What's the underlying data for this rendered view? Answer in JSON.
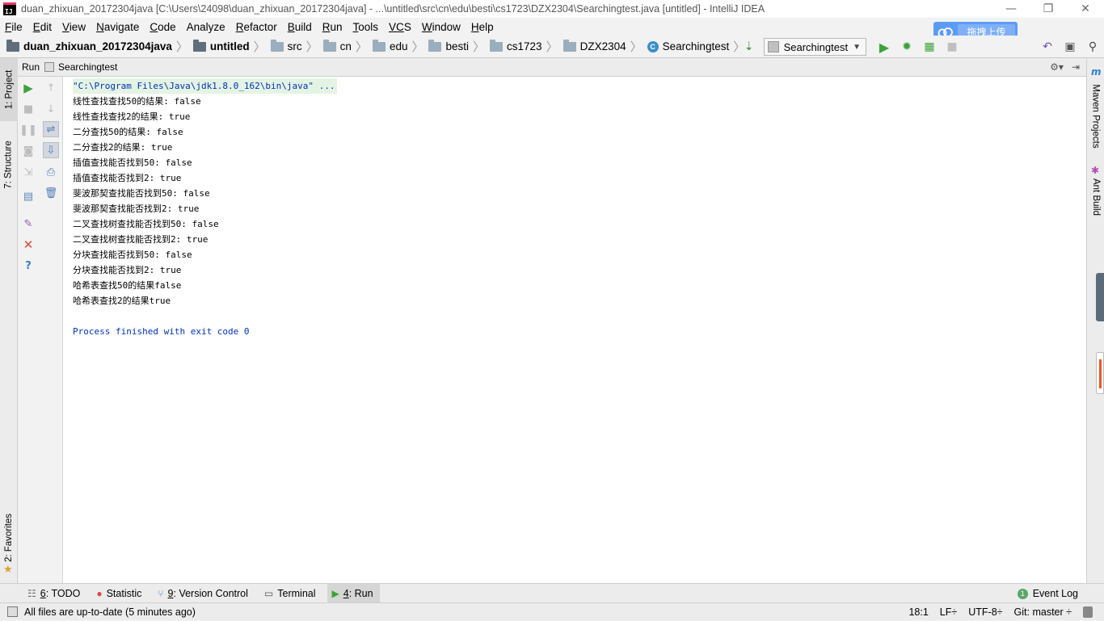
{
  "window": {
    "title": "duan_zhixuan_20172304java [C:\\Users\\24098\\duan_zhixuan_20172304java] - ...\\untitled\\src\\cn\\edu\\besti\\cs1723\\DZX2304\\Searchingtest.java [untitled] - IntelliJ IDEA",
    "controls": [
      "—",
      "❐",
      "✕"
    ]
  },
  "menu": [
    {
      "first": "F",
      "rest": "ile"
    },
    {
      "first": "E",
      "rest": "dit"
    },
    {
      "first": "V",
      "rest": "iew"
    },
    {
      "first": "N",
      "rest": "avigate"
    },
    {
      "first": "C",
      "rest": "ode"
    },
    {
      "first": "",
      "rest": "Analyze"
    },
    {
      "first": "R",
      "rest": "efactor"
    },
    {
      "first": "B",
      "rest": "uild"
    },
    {
      "first": "R",
      "rest": "un"
    },
    {
      "first": "T",
      "rest": "ools"
    },
    {
      "first": "VC",
      "rest": "S"
    },
    {
      "first": "W",
      "rest": "indow"
    },
    {
      "first": "H",
      "rest": "elp"
    }
  ],
  "breadcrumb": [
    "duan_zhixuan_20172304java",
    "untitled",
    "src",
    "cn",
    "edu",
    "besti",
    "cs1723",
    "DZX2304",
    "Searchingtest"
  ],
  "run_config": "Searchingtest",
  "upload_label": "拖拽上传",
  "left_tabs": {
    "project": "1: Project",
    "structure": "7: Structure",
    "favorites": "2: Favorites"
  },
  "right_tabs": {
    "maven": "Maven Projects",
    "ant": "Ant Build"
  },
  "run_panel": {
    "label": "Run",
    "tab": "Searchingtest"
  },
  "console": {
    "command": "\"C:\\Program Files\\Java\\jdk1.8.0_162\\bin\\java\" ...",
    "lines": [
      "线性查找查找50的结果: false",
      "线性查找查找2的结果: true",
      "二分查找50的结果: false",
      "二分查找2的结果: true",
      "插值查找能否找到50: false",
      "插值查找能否找到2: true",
      "斐波那契查找能否找到50: false",
      "斐波那契查找能否找到2: true",
      "二叉查找树查找能否找到50: false",
      "二叉查找树查找能否找到2: true",
      "分块查找能否找到50: false",
      "分块查找能否找到2: true",
      "哈希表查找50的结果false",
      "哈希表查找2的结果true"
    ],
    "exit": "Process finished with exit code 0"
  },
  "tool_windows": [
    {
      "num": "6",
      "label": ": TODO",
      "icon": "todo-icon"
    },
    {
      "num": "",
      "label": "Statistic",
      "icon": "statistic-icon"
    },
    {
      "num": "9",
      "label": ": Version Control",
      "icon": "vcs-icon"
    },
    {
      "num": "",
      "label": "Terminal",
      "icon": "terminal-icon"
    },
    {
      "num": "4",
      "label": ": Run",
      "icon": "run-icon"
    }
  ],
  "event_log": {
    "count": "1",
    "label": "Event Log"
  },
  "status": {
    "message": "All files are up-to-date (5 minutes ago)",
    "position": "18:1",
    "line_sep": "LF÷",
    "encoding": "UTF-8÷",
    "git": "Git: master ÷"
  }
}
